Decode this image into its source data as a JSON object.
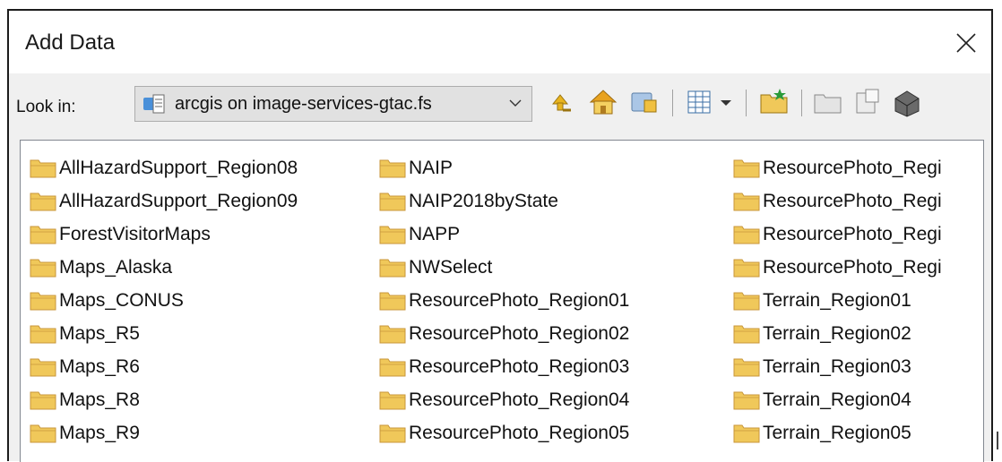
{
  "window": {
    "title": "Add Data"
  },
  "toolbar": {
    "look_in_label": "Look in:",
    "location": "arcgis on image-services-gtac.fs",
    "buttons": [
      "up-one-level-icon",
      "home-icon",
      "catalog-connect-icon",
      "view-options-icon",
      "new-folder-icon",
      "folder-connect-icon",
      "new-item-icon",
      "toolbox-icon"
    ]
  },
  "folders": {
    "col1": [
      "AllHazardSupport_Region08",
      "AllHazardSupport_Region09",
      "ForestVisitorMaps",
      "Maps_Alaska",
      "Maps_CONUS",
      "Maps_R5",
      "Maps_R6",
      "Maps_R8",
      "Maps_R9"
    ],
    "col2": [
      "NAIP",
      "NAIP2018byState",
      "NAPP",
      "NWSelect",
      "ResourcePhoto_Region01",
      "ResourcePhoto_Region02",
      "ResourcePhoto_Region03",
      "ResourcePhoto_Region04",
      "ResourcePhoto_Region05"
    ],
    "col3": [
      "ResourcePhoto_Regi",
      "ResourcePhoto_Regi",
      "ResourcePhoto_Regi",
      "ResourcePhoto_Regi",
      "Terrain_Region01",
      "Terrain_Region02",
      "Terrain_Region03",
      "Terrain_Region04",
      "Terrain_Region05"
    ]
  },
  "colors": {
    "folder": "#f0c85a",
    "folder_edge": "#c8963a",
    "accent": "#1c6fd1"
  }
}
